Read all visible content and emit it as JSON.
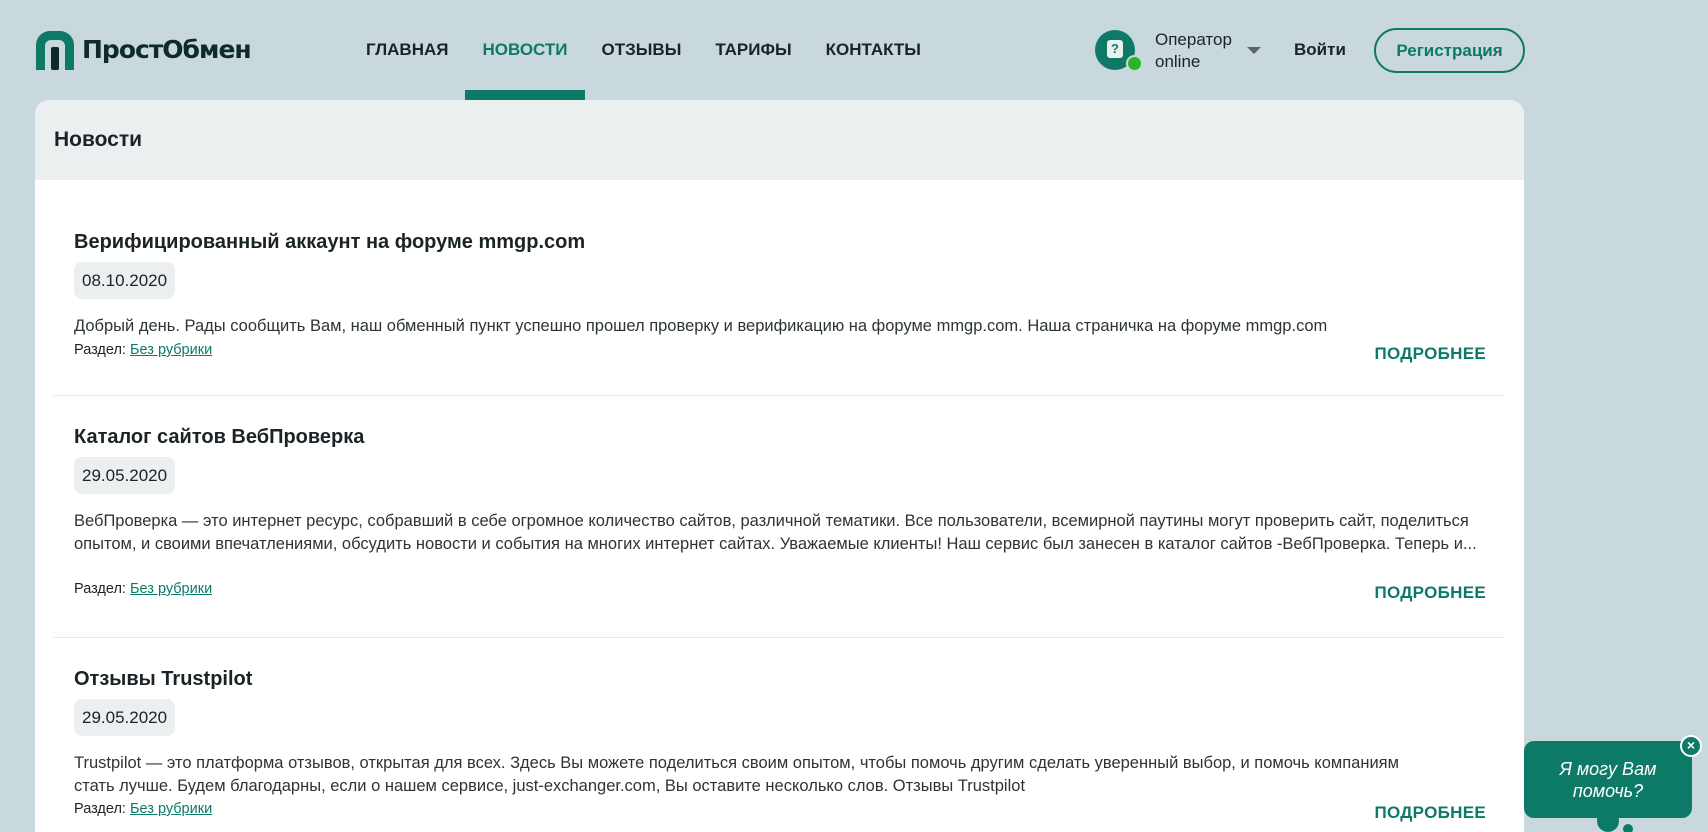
{
  "header": {
    "logo_text": "ПростОбмен",
    "nav": [
      {
        "label": "ГЛАВНАЯ",
        "active": false
      },
      {
        "label": "НОВОСТИ",
        "active": true
      },
      {
        "label": "ОТЗЫВЫ",
        "active": false
      },
      {
        "label": "ТАРИФЫ",
        "active": false
      },
      {
        "label": "КОНТАКТЫ",
        "active": false
      }
    ],
    "operator": {
      "name": "Оператор",
      "status": "online"
    },
    "login_label": "Войти",
    "register_label": "Регистрация"
  },
  "main": {
    "title": "Новости",
    "posts": [
      {
        "title": "Верифицированный аккаунт на форуме mmgp.com",
        "date": "08.10.2020",
        "text": "Добрый день. Рады сообщить Вам, наш обменный пункт успешно прошел проверку и верификацию на форуме mmgp.com. Наша страничка на форуме mmgp.com",
        "category_label": "Раздел:",
        "category": "Без рубрики",
        "more_label": "ПОДРОБНЕЕ"
      },
      {
        "title": "Каталог сайтов ВебПроверка",
        "date": "29.05.2020",
        "text": "ВебПроверка — это интернет ресурс, собравший в себе огромное количество сайтов, различной тематики. Все пользователи, всемирной паутины могут проверить сайт, поделиться опытом, и своими впечатлениями, обсудить новости и события на многих интернет сайтах. Уважаемые клиенты! Наш сервис был занесен в каталог сайтов -ВебПроверка. Теперь и...",
        "category_label": "Раздел:",
        "category": "Без рубрики",
        "more_label": "ПОДРОБНЕЕ"
      },
      {
        "title": "Отзывы Trustpilot",
        "date": "29.05.2020",
        "text": "Trustpilot — это платформа отзывов, открытая для всех. Здесь Вы можете поделиться своим опытом, чтобы помочь другим сделать уверенный выбор, и помочь компаниям стать лучше. Будем благодарны, если о нашем сервисе, just-exchanger.com, Вы оставите несколько слов. Отзывы Trustpilot",
        "category_label": "Раздел:",
        "category": "Без рубрики",
        "more_label": "ПОДРОБНЕЕ"
      }
    ]
  },
  "chat": {
    "text": "Я могу Вам помочь?",
    "close_label": "×"
  },
  "colors": {
    "accent": "#0d7a68",
    "background": "#c9d8dc",
    "online": "#2db52a"
  }
}
